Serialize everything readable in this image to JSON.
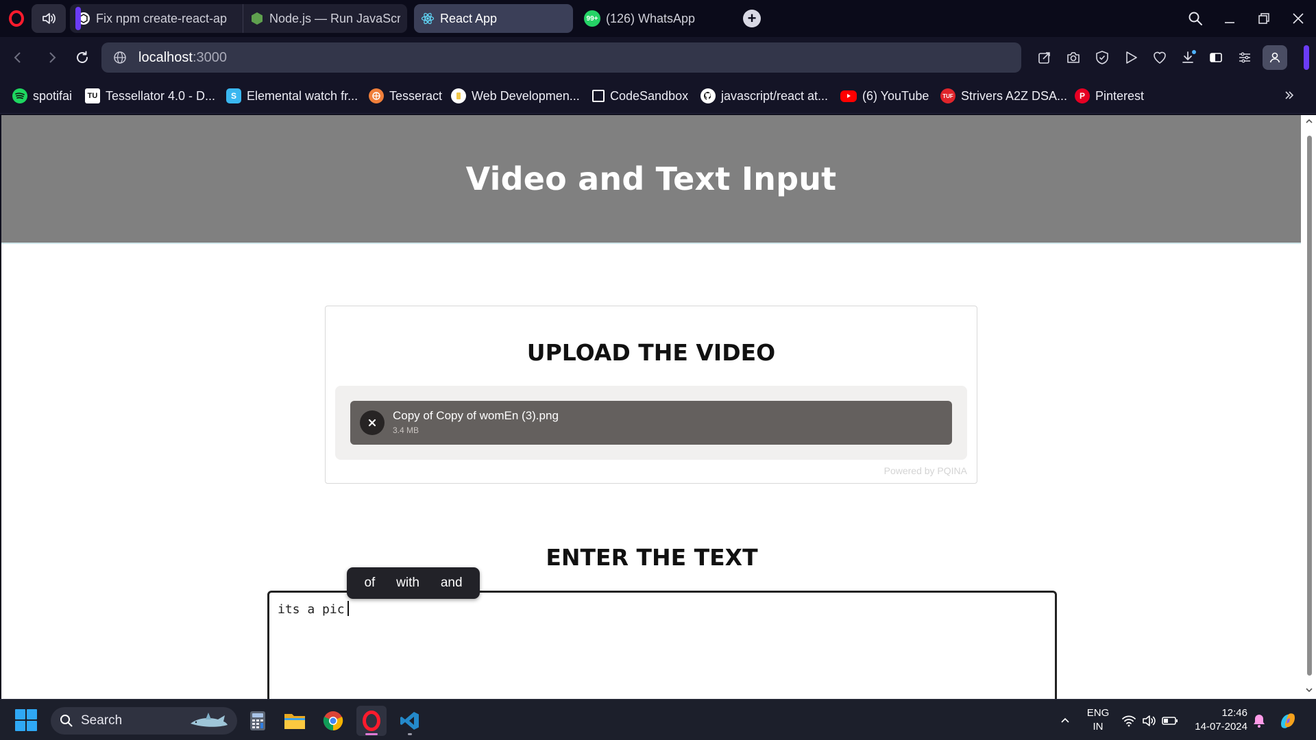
{
  "browser": {
    "tabs": [
      {
        "label": "Fix npm create-react-ap",
        "icon": "chatgpt-icon",
        "active": false
      },
      {
        "label": "Node.js — Run JavaScrip",
        "icon": "nodejs-icon",
        "active": false
      },
      {
        "label": "React App",
        "icon": "react-icon",
        "active": true
      },
      {
        "label": "(126) WhatsApp",
        "icon": "whatsapp-icon",
        "active": false
      }
    ],
    "whatsapp_badge": "99+",
    "new_tab_symbol": "+",
    "url": {
      "host": "localhost",
      "port": ":3000"
    },
    "accent_color": "#6b3cf7"
  },
  "bookmarks": [
    {
      "label": "spotifai",
      "icon": "spotify-icon",
      "color": "#1ed760"
    },
    {
      "label": "Tessellator 4.0 - D...",
      "icon": "tessellator-icon",
      "color": "#ffffff"
    },
    {
      "label": "Elemental watch fr...",
      "icon": "elemental-icon",
      "color": "#3ab7f0"
    },
    {
      "label": "Tesseract",
      "icon": "tesseract-icon",
      "color": "#f07f3a"
    },
    {
      "label": "Web Developmen...",
      "icon": "webdev-icon",
      "color": "#f2c84b"
    },
    {
      "label": "CodeSandbox",
      "icon": "codesandbox-icon",
      "color": "#ffffff"
    },
    {
      "label": "javascript/react at...",
      "icon": "github-icon",
      "color": "#ffffff"
    },
    {
      "label": "(6) YouTube",
      "icon": "youtube-icon",
      "color": "#ff0000"
    },
    {
      "label": "Strivers A2Z DSA...",
      "icon": "tuf-icon",
      "color": "#e0252b"
    },
    {
      "label": "Pinterest",
      "icon": "pinterest-icon",
      "color": "#e60023"
    }
  ],
  "page": {
    "header_title": "Video and Text Input",
    "header_bg": "#808080",
    "upload": {
      "heading": "UPLOAD THE VIDEO",
      "file_name": "Copy of Copy of womEn (3).png",
      "file_size": "3.4 MB",
      "powered_by": "Powered by PQINA"
    },
    "text_section": {
      "heading": "ENTER THE TEXT",
      "value": "its a pic",
      "suggestions": [
        "of",
        "with",
        "and"
      ]
    }
  },
  "taskbar": {
    "search_label": "Search",
    "apps": [
      "calculator-icon",
      "file-explorer-icon",
      "chrome-icon",
      "opera-icon",
      "vscode-icon"
    ],
    "language": {
      "line1": "ENG",
      "line2": "IN"
    },
    "time": "12:46",
    "date": "14-07-2024"
  }
}
